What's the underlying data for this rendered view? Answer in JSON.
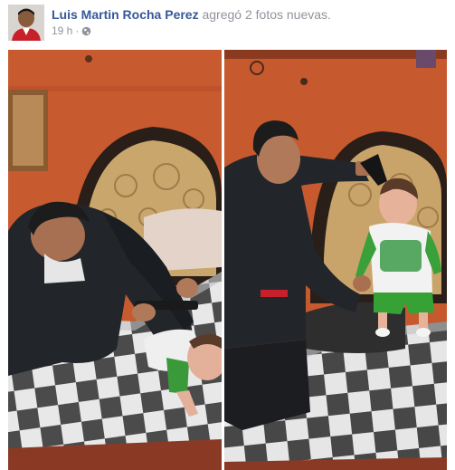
{
  "post": {
    "author_name": "Luis Martin Rocha Perez",
    "action_text": "agregó 2 fotos nuevas.",
    "timestamp": "19 h",
    "separator": "·",
    "privacy_icon": "globe-icon"
  },
  "photos": [
    {
      "id_label": "photo-1"
    },
    {
      "id_label": "photo-2"
    }
  ],
  "colors": {
    "author_link": "#365899",
    "meta_text": "#90949c",
    "wall": "#c4562f",
    "checker_dark": "#4a4a4a",
    "checker_light": "#e9e9e9",
    "jacket": "#22262b"
  }
}
